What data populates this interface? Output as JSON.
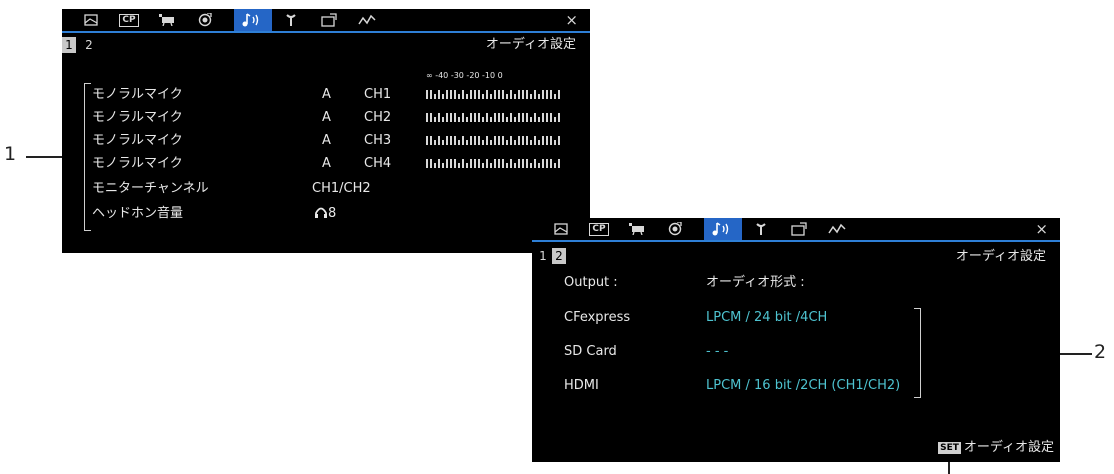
{
  "callouts": {
    "left": "1",
    "right": "2"
  },
  "tab_icons": [
    "camera-image-icon",
    "cp-icon",
    "camera-movie-icon",
    "color-wheel-icon",
    "audio-icon",
    "wrench-icon",
    "custom-button-icon",
    "assist-wave-icon"
  ],
  "tab_cp_label": "CP",
  "panel1": {
    "pages": [
      "1",
      "2"
    ],
    "title": "オーディオ設定",
    "meter_scale": "∞ -40  -30  -20  -10    0",
    "mic_rows": [
      {
        "label": "モノラルマイク",
        "input": "A",
        "channel": "CH1"
      },
      {
        "label": "モノラルマイク",
        "input": "A",
        "channel": "CH2"
      },
      {
        "label": "モノラルマイク",
        "input": "A",
        "channel": "CH3"
      },
      {
        "label": "モノラルマイク",
        "input": "A",
        "channel": "CH4"
      }
    ],
    "monitor_label": "モニターチャンネル",
    "monitor_value": "CH1/CH2",
    "headphone_label": "ヘッドホン音量",
    "headphone_value": "8",
    "close": "×"
  },
  "panel2": {
    "pages": [
      "1",
      "2"
    ],
    "title": "オーディオ設定",
    "output_label": "Output :",
    "format_label": "オーディオ形式 :",
    "rows": [
      {
        "label": "CFexpress",
        "value": "LPCM / 24 bit /4CH"
      },
      {
        "label": "SD Card",
        "value": "- - -"
      },
      {
        "label": "HDMI",
        "value": "LPCM / 16 bit /2CH (CH1/CH2)"
      }
    ],
    "set_key": "SET",
    "set_label": "オーディオ設定",
    "close": "×"
  },
  "colors": {
    "accent": "#2566c6",
    "value": "#4ec3d0",
    "panel_bg": "#000000"
  }
}
